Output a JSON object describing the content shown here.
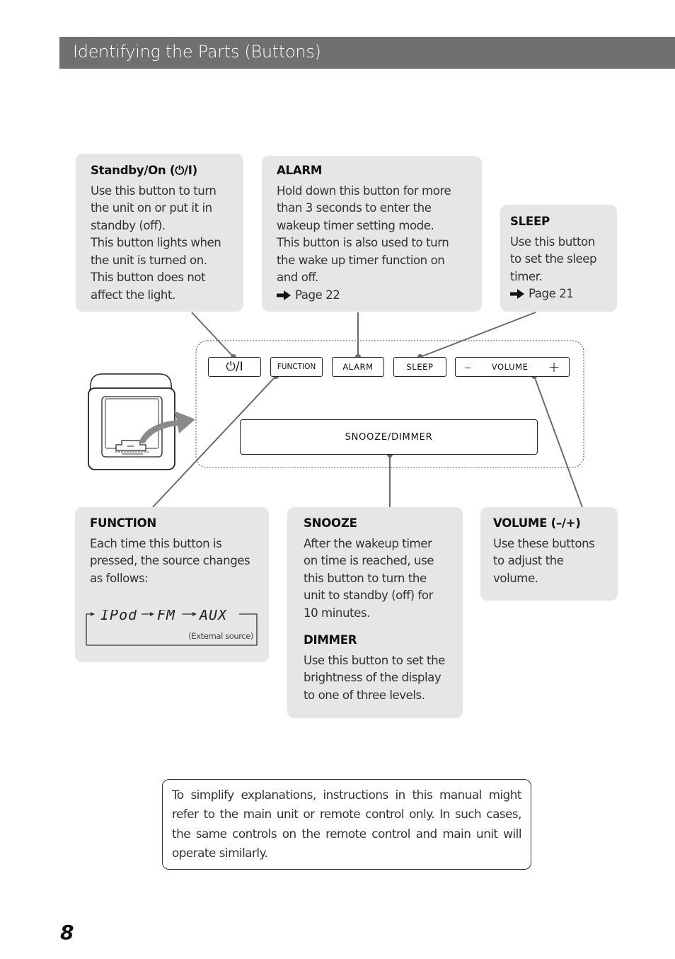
{
  "header": {
    "title": "Identifying the Parts (Buttons)"
  },
  "callouts": {
    "standby": {
      "title": "Standby/On (⏻/I)",
      "text": "Use this button to turn\nthe unit on or put it in\nstandby (off).\nThis button lights when\nthe unit is turned on.\nThis button does not\naffect the light."
    },
    "alarm": {
      "title": "ALARM",
      "text": "Hold down this button for more\nthan 3 seconds to enter the\nwakeup timer setting mode.\nThis button is also used to turn\nthe  wake up timer function on\nand off.",
      "page_ref": "Page 22"
    },
    "sleep": {
      "title": "SLEEP",
      "text": "Use this button\nto set the sleep\ntimer.",
      "page_ref": "Page 21"
    },
    "function": {
      "title": "FUNCTION",
      "text": "Each time this button is\npressed, the source changes\nas follows:",
      "sequence": [
        "IPod",
        "FM",
        "AUX"
      ],
      "external_note": "(External source)"
    },
    "snooze": {
      "title": "SNOOZE",
      "text": "After the wakeup timer\non time is reached, use\nthis button to turn the\nunit to standby (off) for\n10 minutes."
    },
    "dimmer": {
      "title": "DIMMER",
      "text": "Use this button to set the\nbrightness of the display\nto one of three levels."
    },
    "volume": {
      "title": "VOLUME (–/+)",
      "text": "Use these buttons\nto adjust the\nvolume."
    }
  },
  "panel": {
    "standby_label": "⏻/I",
    "function_label": "FUNCTION",
    "alarm_label": "ALARM",
    "sleep_label": "SLEEP",
    "volume_minus": "–",
    "volume_label": "VOLUME",
    "volume_plus": "+",
    "snooze_label": "SNOOZE/DIMMER"
  },
  "note": "To simplify explanations, instructions in this manual might refer to the main unit or remote control only. In such cases, the same controls on the remote control and main unit will operate similarly.",
  "page_number": "8",
  "colors": {
    "header_bg": "#707070",
    "callout_bg": "#e6e6e6",
    "leader_line": "#6b6b6b"
  }
}
